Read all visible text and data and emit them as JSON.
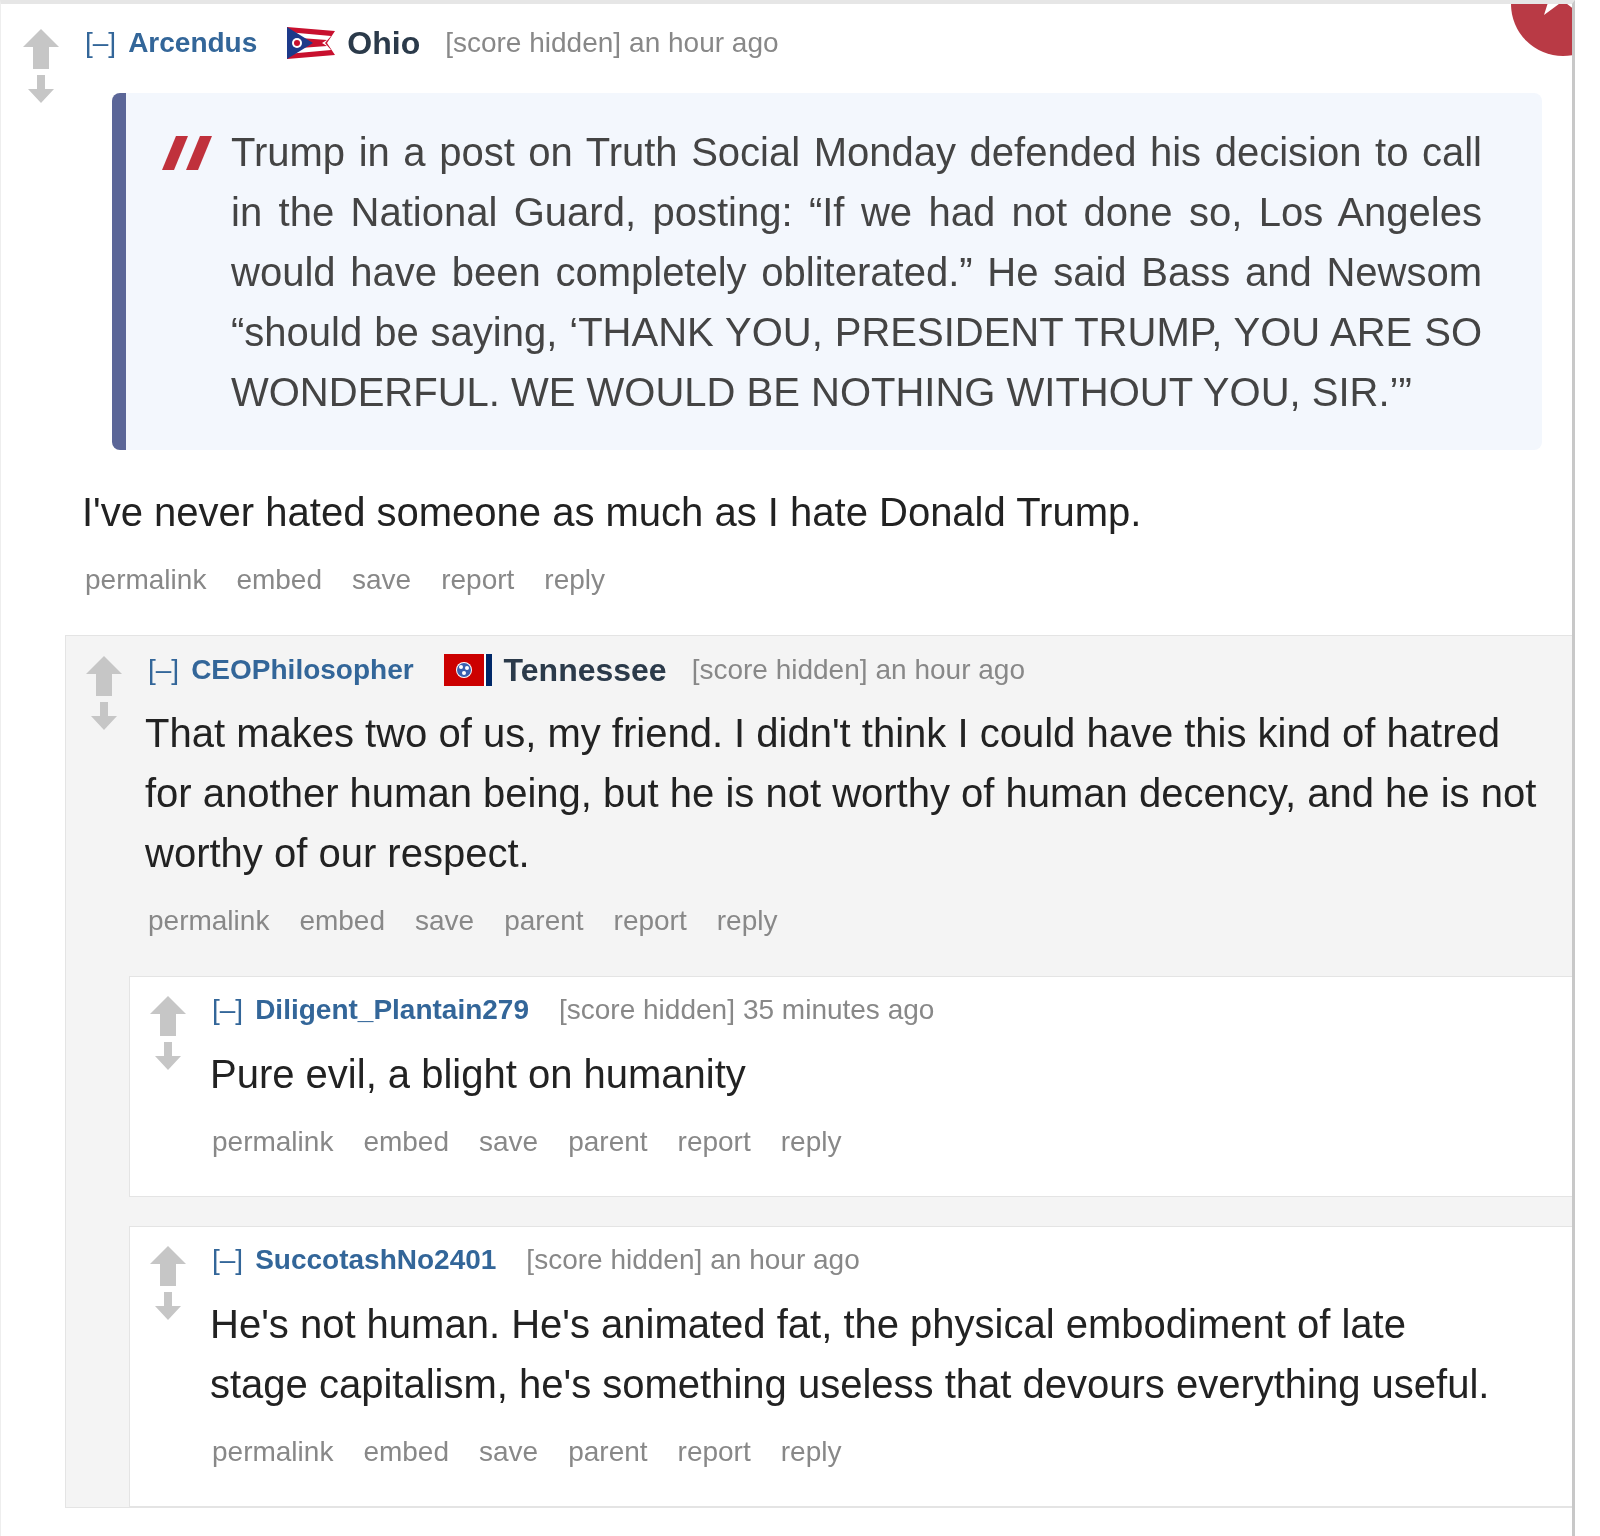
{
  "comments": [
    {
      "collapse": "[–]",
      "user": "Arcendus",
      "flair": {
        "kind": "ohio",
        "text": "Ohio"
      },
      "score": "[score hidden]",
      "time": "an hour ago",
      "quote": "Trump in a post on Truth Social Monday defended his decision to call in the National Guard, posting: “If we had not done so, Los Angeles would have been completely obliterated.” He said Bass and Newsom “should be saying, ‘THANK YOU, PRESIDENT TRUMP, YOU ARE SO WONDERFUL. WE WOULD BE NOTHING WITHOUT YOU, SIR.’”",
      "body": "I've never hated someone as much as I hate Donald Trump.",
      "actions": [
        "permalink",
        "embed",
        "save",
        "report",
        "reply"
      ],
      "children": [
        {
          "collapse": "[–]",
          "user": "CEOPhilosopher",
          "flair": {
            "kind": "tennessee",
            "text": "Tennessee"
          },
          "score": "[score hidden]",
          "time": "an hour ago",
          "body": "That makes two of us, my friend. I didn't think I could have this kind of hatred for another human being, but he is not worthy of human decency, and he is not worthy of our respect.",
          "actions": [
            "permalink",
            "embed",
            "save",
            "parent",
            "report",
            "reply"
          ],
          "children": [
            {
              "collapse": "[–]",
              "user": "Diligent_Plantain279",
              "score": "[score hidden]",
              "time": "35 minutes ago",
              "body": "Pure evil, a blight on humanity",
              "actions": [
                "permalink",
                "embed",
                "save",
                "parent",
                "report",
                "reply"
              ]
            },
            {
              "collapse": "[–]",
              "user": "SuccotashNo2401",
              "score": "[score hidden]",
              "time": "an hour ago",
              "body": "He's not human. He's animated fat, the physical embodiment of late stage capitalism, he's something useless that devours everything useful.",
              "actions": [
                "permalink",
                "embed",
                "save",
                "parent",
                "report",
                "reply"
              ]
            }
          ]
        }
      ]
    }
  ]
}
